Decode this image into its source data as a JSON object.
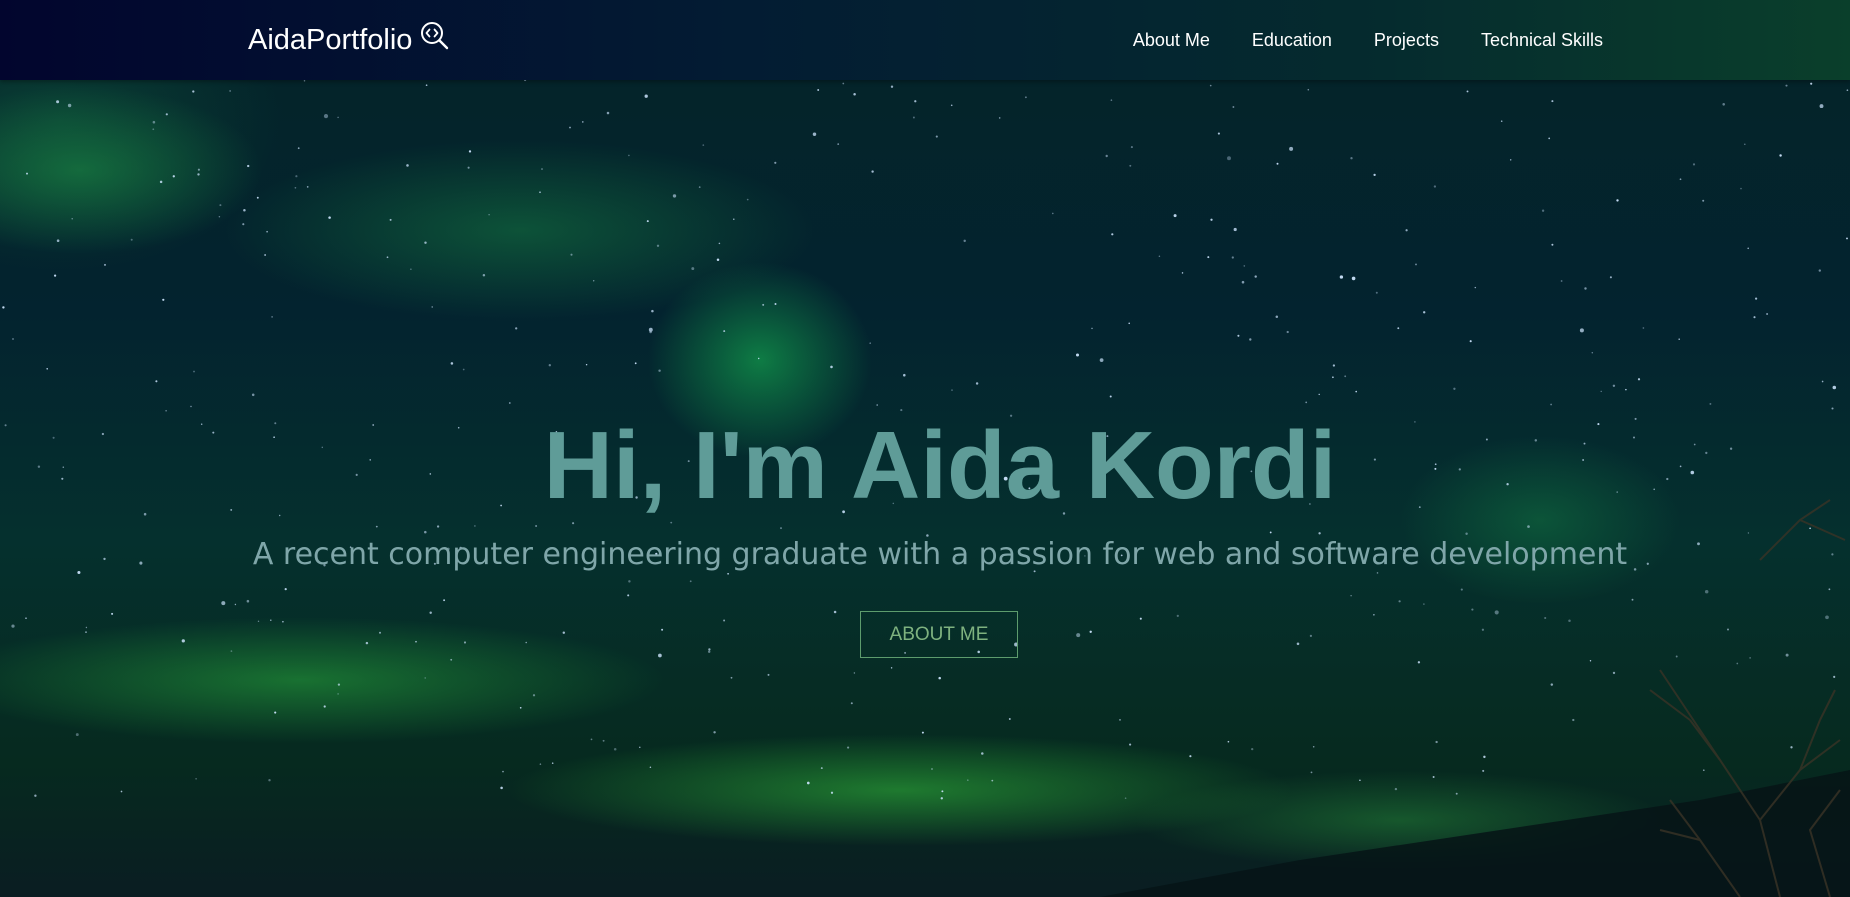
{
  "nav": {
    "brand": "AidaPortfolio",
    "brand_icon": "code-search-icon",
    "links": [
      "About Me",
      "Education",
      "Projects",
      "Technical Skills"
    ]
  },
  "hero": {
    "title": "Hi, I'm Aida Kordi",
    "subtitle": "A recent computer engineering graduate with a passion for web and software development",
    "button_label": "ABOUT ME"
  },
  "colors": {
    "title": "#5f9c98",
    "subtitle": "#7fa6a9",
    "button": "#7eb27f",
    "nav_start": "#02052e",
    "nav_end": "#0a3f2b"
  }
}
